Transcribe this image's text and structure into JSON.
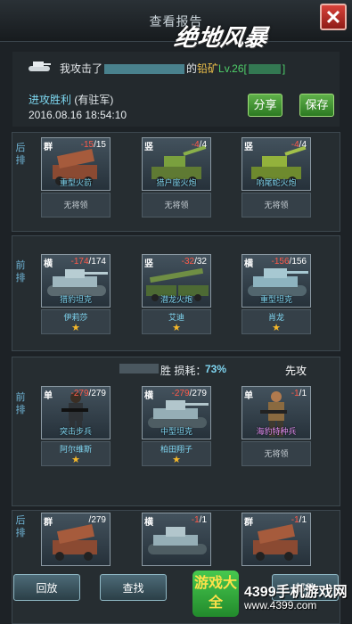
{
  "window": {
    "title": "查看报告",
    "logo": "绝地风暴",
    "close_label": "✕"
  },
  "report": {
    "attack_prefix": "我攻击了",
    "attack_suffix": "的",
    "target_name": "铅矿",
    "target_level": "Lv.26",
    "result": "进攻胜利",
    "result_note": "(有驻军)",
    "time": "2016.08.16 18:54:10",
    "share_label": "分享",
    "save_label": "保存"
  },
  "side1": {
    "rear_label": "后排",
    "front_label": "前排",
    "rear": [
      {
        "pos": "群",
        "loss": "-15",
        "max": "15",
        "name": "重型火箭",
        "general": "无将领",
        "has_general": false
      },
      {
        "pos": "竖",
        "loss": "-4",
        "max": "4",
        "name": "猎户座火炮",
        "general": "无将领",
        "has_general": false
      },
      {
        "pos": "竖",
        "loss": "-4",
        "max": "4",
        "name": "响尾蛇火炮",
        "general": "无将领",
        "has_general": false
      }
    ],
    "front": [
      {
        "pos": "横",
        "loss": "-174",
        "max": "174",
        "name": "猎豹坦克",
        "general": "伊莉莎",
        "has_general": true
      },
      {
        "pos": "竖",
        "loss": "-32",
        "max": "32",
        "name": "潜龙火炮",
        "general": "艾迪",
        "has_general": true
      },
      {
        "pos": "横",
        "loss": "-156",
        "max": "156",
        "name": "重型坦克",
        "general": "肖龙",
        "has_general": true
      }
    ]
  },
  "side2": {
    "result_text": "胜 损耗：",
    "loss_pct": "73%",
    "first_strike": "先攻",
    "front_label": "前排",
    "rear_label": "后排",
    "front": [
      {
        "pos": "单",
        "loss": "-279",
        "max": "279",
        "name": "突击步兵",
        "general": "阿尔维斯",
        "has_general": true
      },
      {
        "pos": "横",
        "loss": "-279",
        "max": "279",
        "name": "中型坦克",
        "general": "柏田翔子",
        "has_general": true
      },
      {
        "pos": "单",
        "loss": "-1",
        "max": "1",
        "name": "海豹特种兵",
        "general": "无将领",
        "has_general": false
      }
    ],
    "rear": [
      {
        "pos": "群",
        "loss": "",
        "max": "279",
        "name": "",
        "general": "",
        "has_general": false
      },
      {
        "pos": "横",
        "loss": "-1",
        "max": "1",
        "name": "",
        "general": "",
        "has_general": false
      },
      {
        "pos": "群",
        "loss": "-1",
        "max": "1",
        "name": "",
        "general": "",
        "has_general": false
      }
    ]
  },
  "bottom": {
    "replay_label": "回放",
    "search_label": "查找",
    "mail_label": "邮件"
  },
  "watermark": {
    "badge": "游戏大全",
    "site": "4399手机游戏网",
    "url": "www.4399.com"
  },
  "colors": {
    "loss": "#ff5a4a",
    "title_cyan": "#7fd5f0",
    "green_btn": "#2c7a22"
  }
}
